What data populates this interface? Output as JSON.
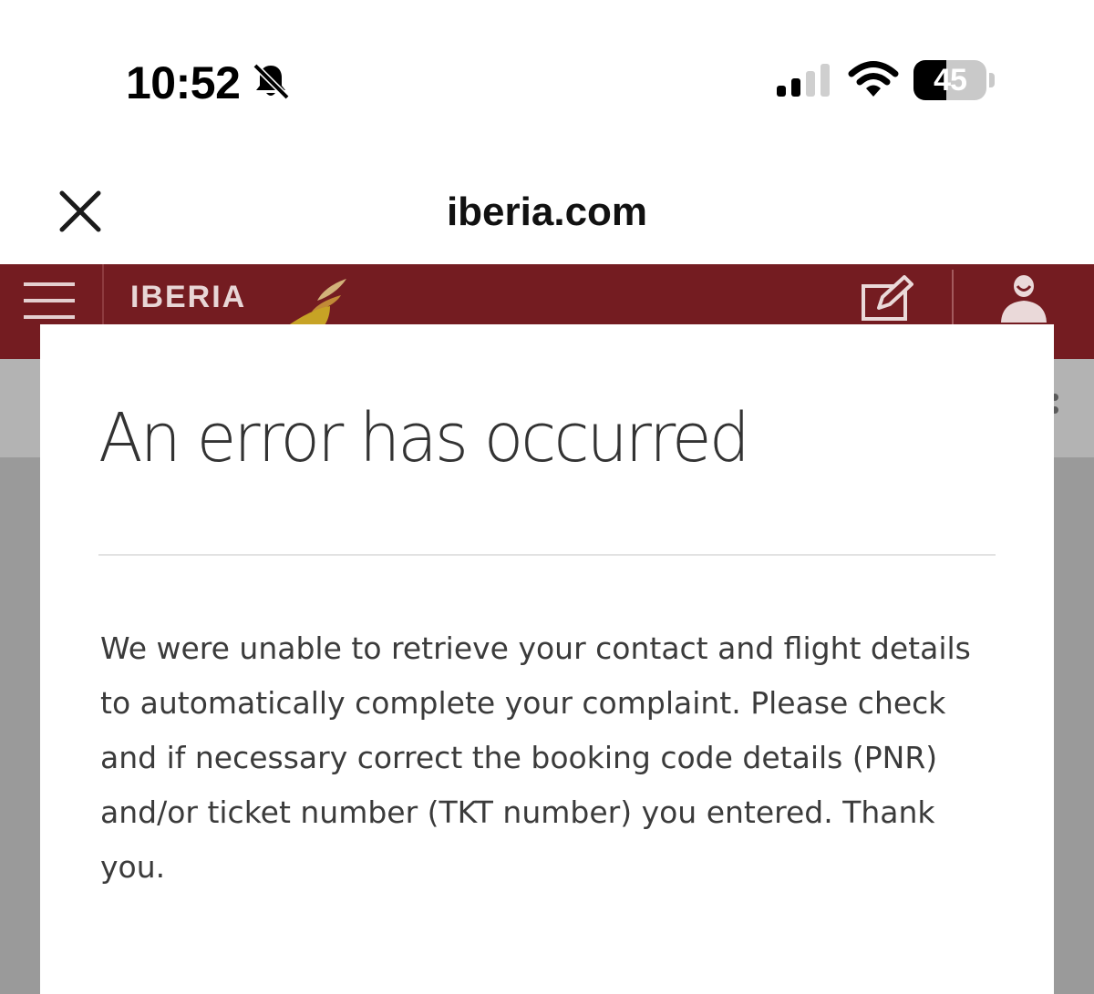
{
  "status_bar": {
    "time": "10:52",
    "battery_level": 45,
    "battery_text": "45",
    "icons": [
      "bell-slash-icon",
      "cellular-signal-icon",
      "wifi-icon",
      "battery-icon"
    ]
  },
  "browser": {
    "title": "iberia.com",
    "close_icon": "close-icon"
  },
  "site_header": {
    "logo_text": "IBERIA",
    "background_color": "#741c21",
    "icons": [
      "hamburger-menu-icon",
      "iberia-mark-icon",
      "edit-icon",
      "user-icon"
    ]
  },
  "modal": {
    "title": "An error has occurred",
    "message": "We were unable to retrieve your contact and flight details to automatically complete your complaint. Please check and if necessary correct the booking code details (PNR) and/or ticket number (TKT number) you entered. Thank you."
  }
}
